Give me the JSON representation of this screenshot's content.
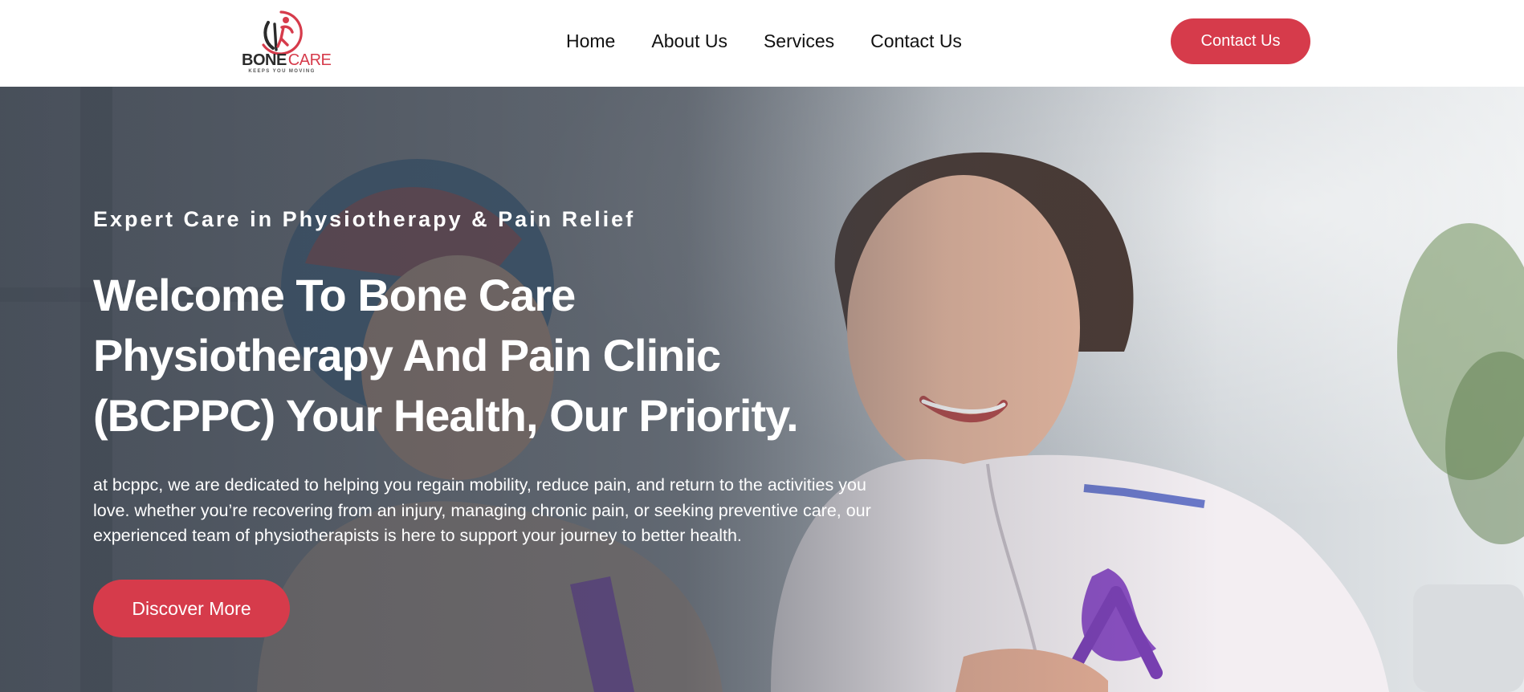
{
  "brand": {
    "name_part1": "BONE",
    "name_part2": "CARE",
    "tagline": "KEEPS YOU MOVING",
    "accent_color": "#d63b4b"
  },
  "nav": {
    "items": [
      {
        "label": "Home"
      },
      {
        "label": "About Us"
      },
      {
        "label": "Services"
      },
      {
        "label": "Contact Us"
      }
    ],
    "cta_label": "Contact Us"
  },
  "hero": {
    "eyebrow": "Expert Care in Physiotherapy & Pain Relief",
    "headline": "Welcome To Bone Care Physiotherapy And Pain Clinic (BCPPC) Your Health, Our Priority.",
    "intro": "at bcppc, we are dedicated to helping you regain mobility, reduce pain, and return to the activities you love. whether you’re recovering from an injury, managing chronic pain, or seeking preventive care, our experienced team of physiotherapists is here to support your journey to better health.",
    "button_label": "Discover More",
    "image_subject": "physiotherapist-with-patient-photo"
  }
}
